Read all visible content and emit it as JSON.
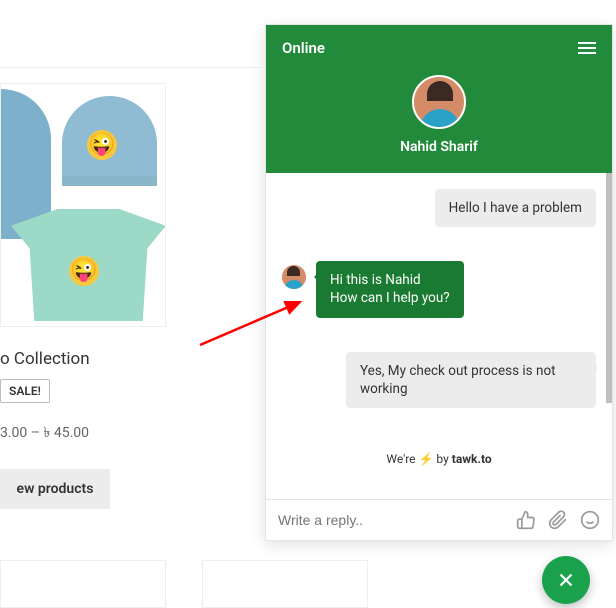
{
  "chat": {
    "status": "Online",
    "agent_name": "Nahid Sharif",
    "messages": {
      "m1": "Hello I have a problem",
      "m2_line1": "Hi this is Nahid",
      "m2_line2": "How can I help you?",
      "m3": "Yes, My check out process is not working"
    },
    "powered_prefix": "We're ",
    "powered_mid": " by ",
    "powered_brand": "tawk.to",
    "input_placeholder": "Write a reply.."
  },
  "product": {
    "title": "o Collection",
    "sale": "SALE!",
    "price": "3.00 – ৳ 45.00",
    "view_btn": "ew products"
  }
}
